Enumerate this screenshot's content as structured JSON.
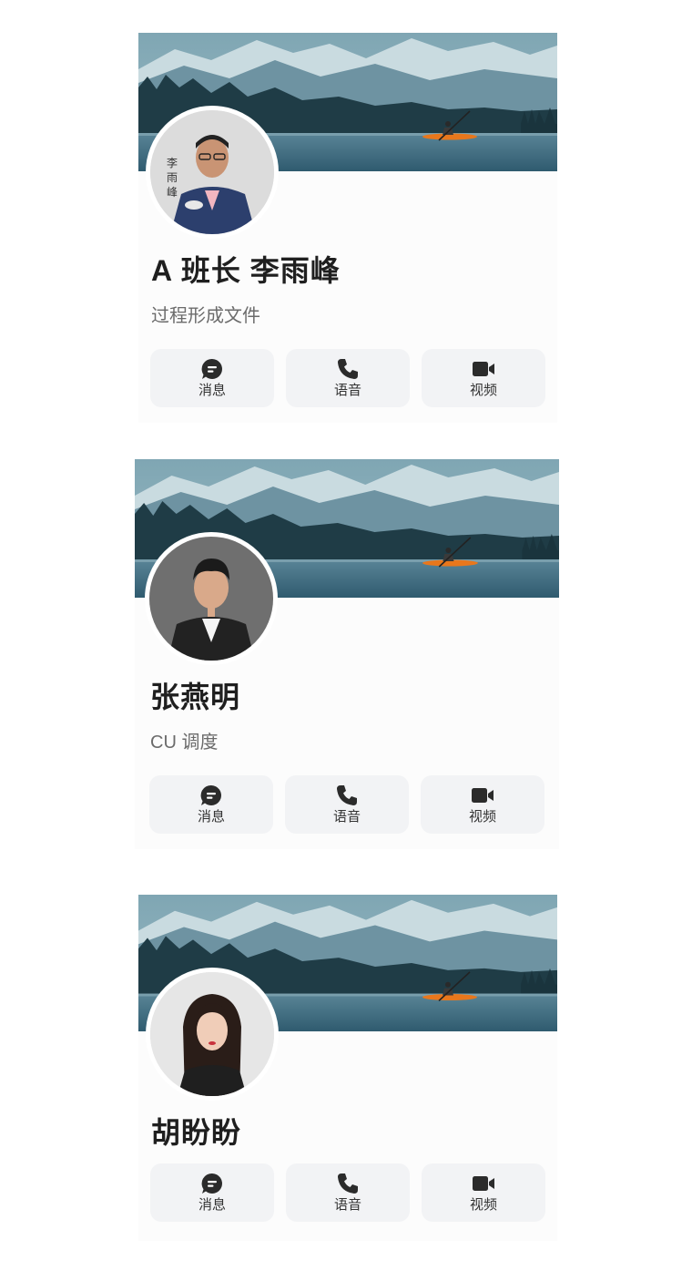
{
  "actions": {
    "message_label": "消息",
    "voice_label": "语音",
    "video_label": "视频"
  },
  "contacts": [
    {
      "name": "A 班长 李雨峰",
      "subtitle": "过程形成文件"
    },
    {
      "name": "张燕明",
      "subtitle": "CU 调度"
    },
    {
      "name": "胡盼盼"
    }
  ],
  "colors": {
    "button_bg": "#f2f3f5",
    "name_text": "#1f1f1f",
    "subtitle_text": "#6b6b6b",
    "icon": "#2b2b2b"
  },
  "icons": {
    "banner": "mountain-lake-kayak-image",
    "message": "chat-bubble-icon",
    "voice": "phone-icon",
    "video": "video-camera-icon"
  }
}
